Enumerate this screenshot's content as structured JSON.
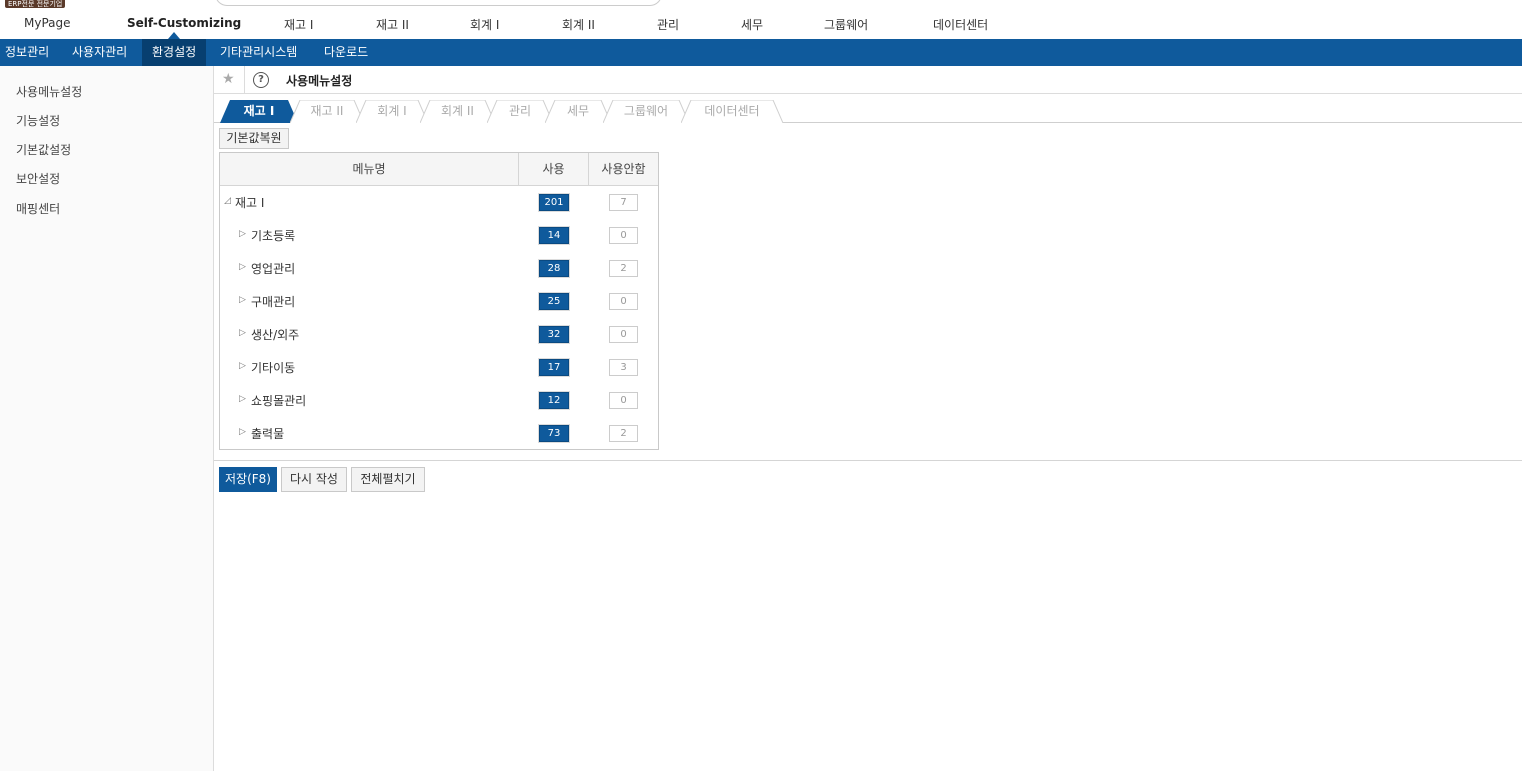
{
  "brand_badge": "ERP전문 전문기업",
  "top_menu": [
    "MyPage",
    "Self-Customizing",
    "재고 I",
    "재고 II",
    "회계 I",
    "회계 II",
    "관리",
    "세무",
    "그룹웨어",
    "데이터센터"
  ],
  "blue_menu": [
    "정보관리",
    "사용자관리",
    "환경설정",
    "기타관리시스템",
    "다운로드"
  ],
  "sidebar": [
    "사용메뉴설정",
    "기능설정",
    "기본값설정",
    "보안설정",
    "매핑센터"
  ],
  "page_title": "사용메뉴설정",
  "tabs": [
    "재고 I",
    "재고 II",
    "회계 I",
    "회계 II",
    "관리",
    "세무",
    "그룹웨어",
    "데이터센터"
  ],
  "restore_button": "기본값복원",
  "table": {
    "headers": [
      "메뉴명",
      "사용",
      "사용안함"
    ],
    "rows": [
      {
        "name": "재고 I",
        "use": "201",
        "nouse": "7"
      },
      {
        "name": "기초등록",
        "use": "14",
        "nouse": "0"
      },
      {
        "name": "영업관리",
        "use": "28",
        "nouse": "2"
      },
      {
        "name": "구매관리",
        "use": "25",
        "nouse": "0"
      },
      {
        "name": "생산/외주",
        "use": "32",
        "nouse": "0"
      },
      {
        "name": "기타이동",
        "use": "17",
        "nouse": "3"
      },
      {
        "name": "쇼핑몰관리",
        "use": "12",
        "nouse": "0"
      },
      {
        "name": "출력물",
        "use": "73",
        "nouse": "2"
      }
    ]
  },
  "bottom_buttons": {
    "save": "저장(F8)",
    "rewrite": "다시 작성",
    "expand": "전체펼치기"
  },
  "icons": {
    "star": "star-icon",
    "help": "help-icon",
    "collapse": "triangle-down-icon",
    "expand": "triangle-right-icon"
  },
  "colors": {
    "primary": "#0f5a9c",
    "active_nav": "#073f70"
  }
}
